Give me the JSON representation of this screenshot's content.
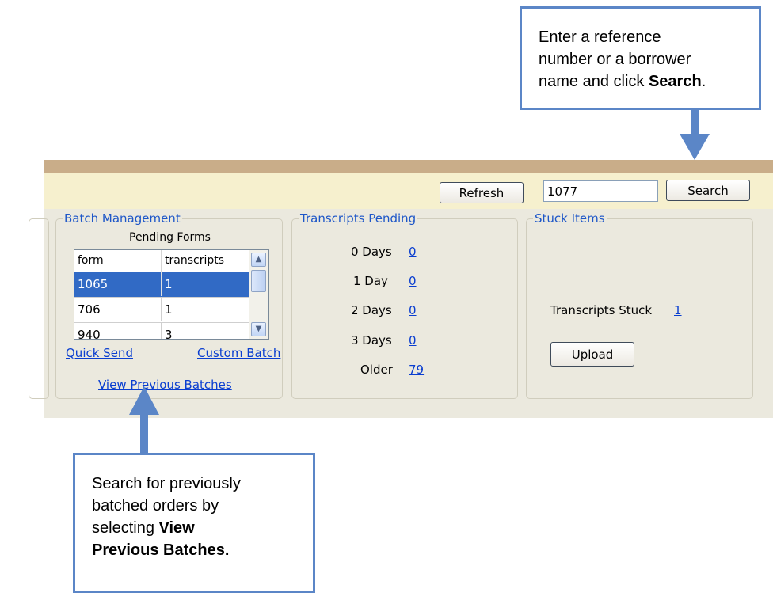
{
  "callouts": {
    "search_hint": {
      "line1": "Enter a reference",
      "line2": "number or a borrower",
      "line3_prefix": "name and click ",
      "line3_bold": "Search",
      "line3_suffix": "."
    },
    "batches_hint": {
      "line1": "Search for previously",
      "line2": "batched orders by",
      "line3_prefix": "selecting ",
      "line3_bold": "View",
      "line4_bold": "Previous Batches."
    }
  },
  "toolbar": {
    "refresh_label": "Refresh",
    "search_value": "1077",
    "search_label": "Search"
  },
  "batch_management": {
    "title": "Batch Management",
    "subtitle": "Pending Forms",
    "columns": [
      "form",
      "transcripts"
    ],
    "rows": [
      {
        "form": "1065",
        "transcripts": "1",
        "selected": true
      },
      {
        "form": "706",
        "transcripts": "1",
        "selected": false
      },
      {
        "form": "940",
        "transcripts": "3",
        "selected": false
      }
    ],
    "quick_send": "Quick Send",
    "custom_batch": "Custom Batch",
    "view_previous": "View Previous Batches"
  },
  "transcripts_pending": {
    "title": "Transcripts Pending",
    "items": [
      {
        "label": "0 Days",
        "count": "0"
      },
      {
        "label": "1 Day",
        "count": "0"
      },
      {
        "label": "2 Days",
        "count": "0"
      },
      {
        "label": "3 Days",
        "count": "0"
      },
      {
        "label": "Older",
        "count": "79"
      }
    ]
  },
  "stuck_items": {
    "title": "Stuck Items",
    "label": "Transcripts Stuck",
    "count": "1",
    "upload_label": "Upload"
  },
  "colors": {
    "callout_border": "#5b86c7",
    "arrow": "#5b86c7",
    "band": "#c9ad89",
    "toolbar": "#f6f0ce",
    "panel": "#ebe9de",
    "link": "#0a3ed0",
    "group_title": "#1d56c8",
    "selection": "#316ac5"
  }
}
